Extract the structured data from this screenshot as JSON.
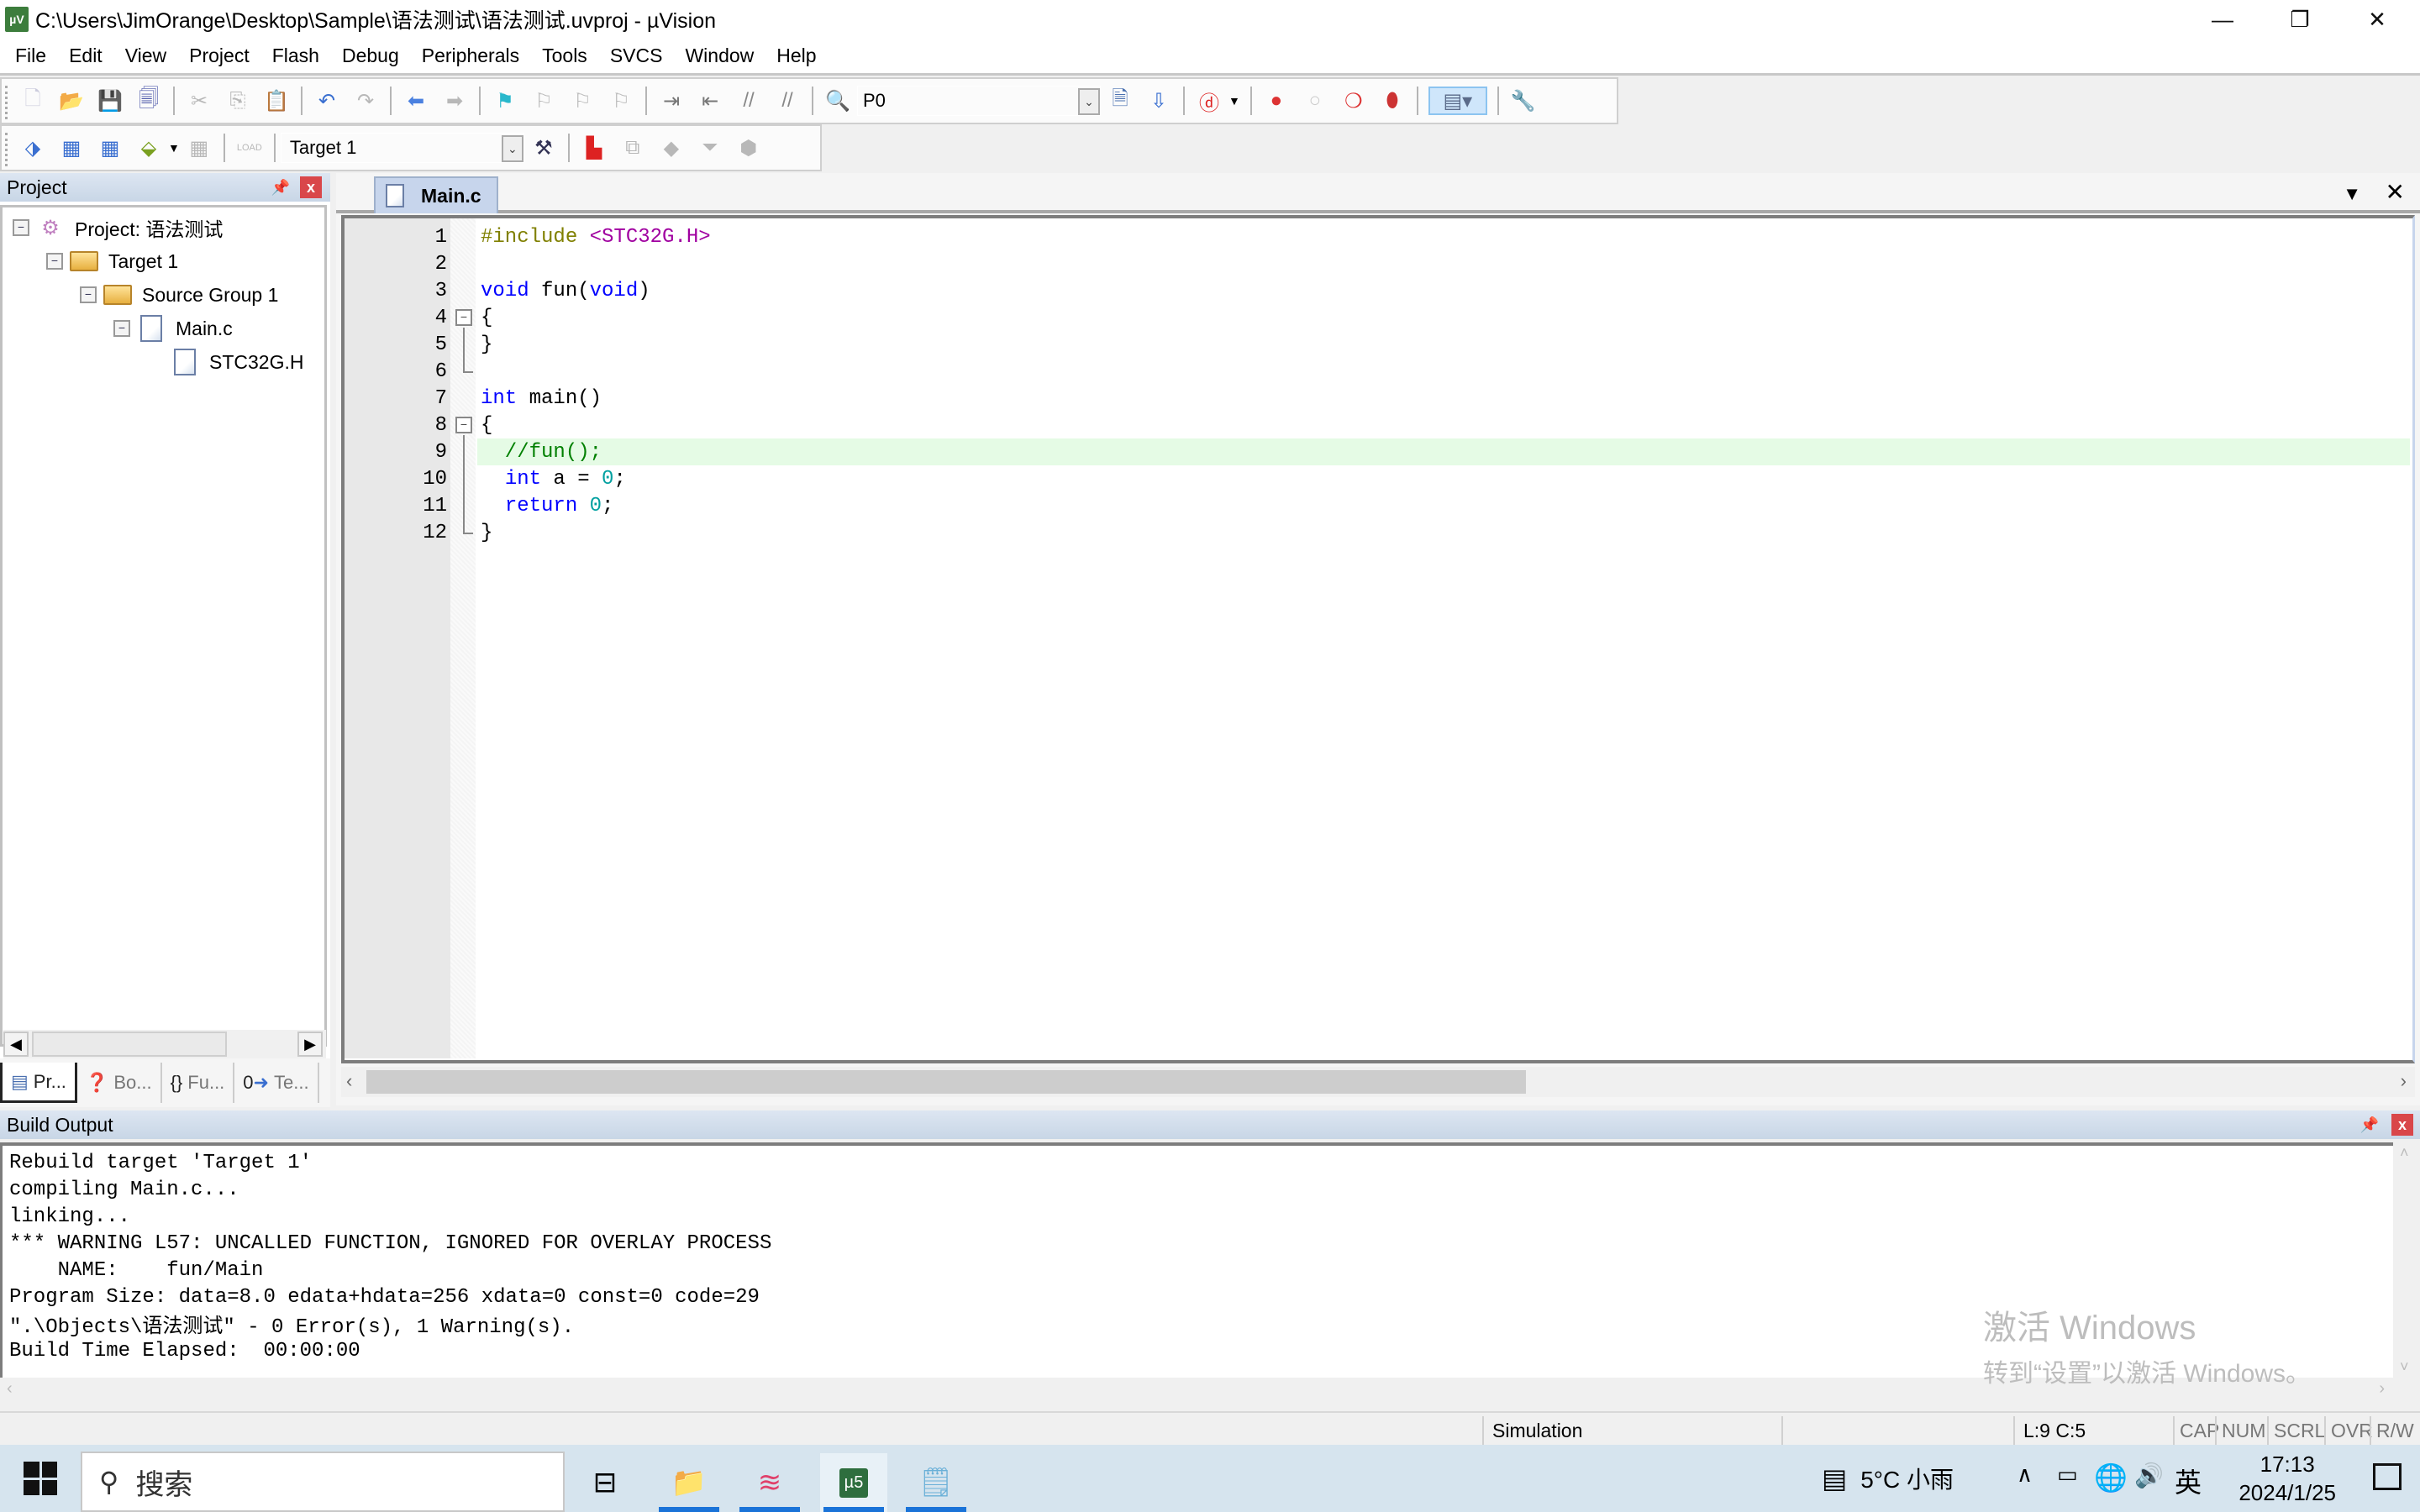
{
  "window": {
    "title": "C:\\Users\\JimOrange\\Desktop\\Sample\\语法测试\\语法测试.uvproj - µVision",
    "app_icon": "uvision-icon",
    "controls": [
      "minimize-icon",
      "restore-icon",
      "close-icon"
    ]
  },
  "menu": [
    "File",
    "Edit",
    "View",
    "Project",
    "Flash",
    "Debug",
    "Peripherals",
    "Tools",
    "SVCS",
    "Window",
    "Help"
  ],
  "toolbar1": {
    "find_value": "P0"
  },
  "toolbar2": {
    "target_value": "Target 1"
  },
  "project_panel": {
    "title": "Project",
    "tree": [
      {
        "label": "Project: 语法测试",
        "level": 0,
        "icon": "project-icon",
        "expanded": true
      },
      {
        "label": "Target 1",
        "level": 1,
        "icon": "target-folder-icon",
        "expanded": true
      },
      {
        "label": "Source Group 1",
        "level": 2,
        "icon": "folder-icon",
        "expanded": true
      },
      {
        "label": "Main.c",
        "level": 3,
        "icon": "c-file-icon",
        "expanded": true
      },
      {
        "label": "STC32G.H",
        "level": 4,
        "icon": "header-file-icon"
      }
    ],
    "tabs": [
      "Pr...",
      "Bo...",
      "Fu...",
      "Te..."
    ]
  },
  "editor": {
    "active_tab": "Main.c",
    "current_line": 9,
    "lines": [
      {
        "n": "1",
        "tokens": [
          {
            "t": "#include ",
            "c": "pp"
          },
          {
            "t": "<STC32G.H>",
            "c": "str"
          }
        ]
      },
      {
        "n": "2",
        "tokens": []
      },
      {
        "n": "3",
        "tokens": [
          {
            "t": "void",
            "c": "kw"
          },
          {
            "t": " fun(",
            "c": ""
          },
          {
            "t": "void",
            "c": "kw"
          },
          {
            "t": ")",
            "c": ""
          }
        ]
      },
      {
        "n": "4",
        "tokens": [
          {
            "t": "{",
            "c": ""
          }
        ]
      },
      {
        "n": "5",
        "tokens": [
          {
            "t": "}",
            "c": ""
          }
        ]
      },
      {
        "n": "6",
        "tokens": []
      },
      {
        "n": "7",
        "tokens": [
          {
            "t": "int",
            "c": "kw"
          },
          {
            "t": " main()",
            "c": ""
          }
        ]
      },
      {
        "n": "8",
        "tokens": [
          {
            "t": "{",
            "c": ""
          }
        ]
      },
      {
        "n": "9",
        "tokens": [
          {
            "t": "  //fun();",
            "c": "cm"
          }
        ]
      },
      {
        "n": "10",
        "tokens": [
          {
            "t": "  ",
            "c": ""
          },
          {
            "t": "int",
            "c": "kw"
          },
          {
            "t": " a = ",
            "c": ""
          },
          {
            "t": "0",
            "c": "num"
          },
          {
            "t": ";",
            "c": ""
          }
        ]
      },
      {
        "n": "11",
        "tokens": [
          {
            "t": "  ",
            "c": ""
          },
          {
            "t": "return",
            "c": "kw"
          },
          {
            "t": " ",
            "c": ""
          },
          {
            "t": "0",
            "c": "num"
          },
          {
            "t": ";",
            "c": ""
          }
        ]
      },
      {
        "n": "12",
        "tokens": [
          {
            "t": "}",
            "c": ""
          }
        ]
      }
    ]
  },
  "build_output": {
    "title": "Build Output",
    "lines": [
      "Rebuild target 'Target 1'",
      "compiling Main.c...",
      "linking...",
      "*** WARNING L57: UNCALLED FUNCTION, IGNORED FOR OVERLAY PROCESS",
      "    NAME:    fun/Main",
      "Program Size: data=8.0 edata+hdata=256 xdata=0 const=0 code=29",
      "\".\\Objects\\语法测试\" - 0 Error(s), 1 Warning(s).",
      "Build Time Elapsed:  00:00:00"
    ]
  },
  "watermark": {
    "line1": "激活 Windows",
    "line2": "转到“设置”以激活 Windows。"
  },
  "status": {
    "mode": "Simulation",
    "cursor": "L:9 C:5",
    "keys": [
      "CAP",
      "NUM",
      "SCRL",
      "OVR",
      "R/W"
    ]
  },
  "taskbar": {
    "search_placeholder": "搜索",
    "weather": "5°C  小雨",
    "ime": "英",
    "time": "17:13",
    "date": "2024/1/25"
  },
  "colors": {
    "keyword": "#0000ff",
    "preprocessor": "#808000",
    "string": "#a000a0",
    "comment": "#008000",
    "number": "#00a0a0",
    "current_line": "#e5fbe5",
    "panel_header": "#c8d6e6",
    "taskbar": "#d6e4ee"
  }
}
